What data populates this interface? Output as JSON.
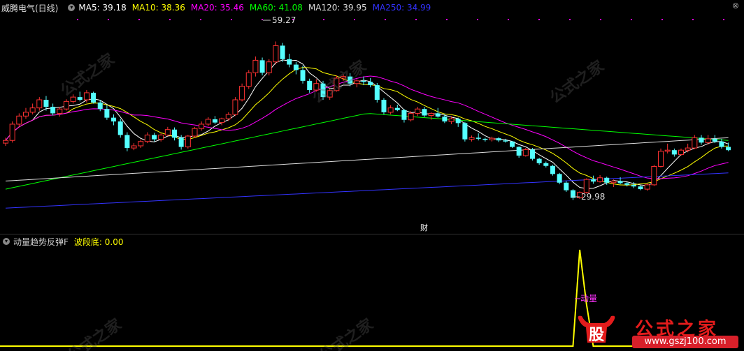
{
  "legend": {
    "stock_name": "威腾电气(日线)",
    "ma": [
      {
        "label": "MA5: 39.18",
        "color": "#ffffff"
      },
      {
        "label": "MA10: 38.36",
        "color": "#ffff00"
      },
      {
        "label": "MA20: 35.46",
        "color": "#ff00ff"
      },
      {
        "label": "MA60: 41.08",
        "color": "#00ff00"
      },
      {
        "label": "MA120: 39.95",
        "color": "#dddddd"
      },
      {
        "label": "MA250: 34.99",
        "color": "#3333ff"
      }
    ]
  },
  "annotations": {
    "high": "59.27",
    "low": "29.98",
    "event_marker": "财"
  },
  "indicator": {
    "name": "动量趋势反弹F",
    "value_label": "波段底: 0.00",
    "tag": "动量"
  },
  "watermark": {
    "text": "公式之家",
    "url": "www.gszj100.com",
    "logo_char": "股"
  },
  "icons": {
    "settings": "circle-down-icon",
    "close": "close-icon"
  },
  "colors": {
    "up": "#ff3232",
    "down": "#54ffff",
    "background": "#000000",
    "indicator": "#ffff00"
  },
  "chart_data": {
    "type": "candlestick",
    "ylim": [
      27.5,
      61
    ],
    "candles": [
      [
        40.5,
        41.5,
        40.0,
        41.0
      ],
      [
        41.0,
        44.5,
        40.6,
        44.0
      ],
      [
        44.0,
        46.0,
        43.5,
        45.5
      ],
      [
        45.5,
        47.0,
        45.0,
        46.2
      ],
      [
        46.2,
        47.8,
        45.8,
        47.0
      ],
      [
        47.0,
        49.0,
        46.5,
        48.5
      ],
      [
        48.5,
        49.2,
        46.5,
        47.2
      ],
      [
        47.2,
        47.8,
        45.6,
        46.0
      ],
      [
        46.0,
        47.2,
        45.4,
        46.8
      ],
      [
        46.8,
        48.6,
        46.5,
        48.2
      ],
      [
        48.2,
        49.5,
        47.8,
        49.0
      ],
      [
        49.0,
        50.0,
        48.2,
        48.5
      ],
      [
        48.5,
        50.3,
        48.0,
        49.8
      ],
      [
        49.8,
        50.0,
        47.8,
        48.0
      ],
      [
        48.0,
        48.5,
        46.4,
        46.8
      ],
      [
        46.8,
        47.5,
        44.8,
        45.2
      ],
      [
        45.2,
        45.8,
        43.8,
        44.5
      ],
      [
        44.5,
        45.0,
        41.5,
        42.0
      ],
      [
        42.0,
        42.5,
        39.0,
        39.6
      ],
      [
        39.6,
        40.5,
        39.2,
        40.0
      ],
      [
        40.0,
        41.2,
        39.6,
        40.8
      ],
      [
        40.8,
        42.5,
        40.5,
        42.0
      ],
      [
        42.0,
        42.4,
        40.8,
        41.2
      ],
      [
        41.2,
        42.3,
        40.8,
        42.0
      ],
      [
        42.0,
        43.5,
        41.8,
        43.0
      ],
      [
        43.0,
        43.4,
        41.0,
        41.5
      ],
      [
        41.5,
        42.0,
        39.3,
        39.8
      ],
      [
        39.8,
        42.0,
        39.5,
        41.8
      ],
      [
        41.8,
        43.5,
        41.5,
        43.2
      ],
      [
        43.2,
        44.5,
        42.8,
        44.0
      ],
      [
        44.0,
        45.3,
        43.6,
        44.9
      ],
      [
        44.9,
        45.5,
        44.0,
        44.3
      ],
      [
        44.3,
        45.2,
        43.8,
        45.0
      ],
      [
        45.0,
        46.2,
        44.6,
        45.8
      ],
      [
        45.8,
        49.0,
        45.5,
        48.5
      ],
      [
        48.5,
        51.5,
        48.2,
        51.0
      ],
      [
        51.0,
        54.0,
        50.5,
        53.5
      ],
      [
        53.5,
        56.5,
        52.8,
        55.8
      ],
      [
        55.8,
        56.3,
        53.0,
        53.5
      ],
      [
        53.5,
        56.0,
        53.0,
        55.5
      ],
      [
        55.5,
        59.27,
        55.0,
        58.5
      ],
      [
        58.5,
        59.0,
        55.5,
        56.0
      ],
      [
        56.0,
        57.0,
        54.5,
        55.0
      ],
      [
        55.0,
        55.5,
        53.2,
        54.0
      ],
      [
        54.0,
        54.8,
        51.5,
        52.0
      ],
      [
        52.0,
        52.4,
        49.8,
        50.3
      ],
      [
        50.3,
        52.3,
        50.0,
        51.5
      ],
      [
        51.5,
        52.0,
        48.5,
        49.0
      ],
      [
        49.0,
        50.5,
        48.5,
        50.2
      ],
      [
        50.2,
        53.0,
        50.0,
        52.5
      ],
      [
        52.5,
        53.2,
        52.0,
        52.8
      ],
      [
        52.8,
        53.4,
        51.0,
        51.5
      ],
      [
        51.5,
        52.3,
        50.8,
        52.0
      ],
      [
        52.0,
        52.8,
        51.2,
        51.8
      ],
      [
        51.8,
        52.5,
        50.8,
        51.2
      ],
      [
        51.2,
        51.6,
        48.0,
        48.5
      ],
      [
        48.5,
        48.8,
        45.8,
        46.2
      ],
      [
        46.2,
        47.5,
        45.8,
        47.0
      ],
      [
        47.0,
        47.6,
        46.4,
        46.6
      ],
      [
        46.6,
        46.8,
        44.3,
        44.8
      ],
      [
        44.8,
        46.4,
        44.5,
        46.0
      ],
      [
        46.0,
        47.2,
        45.5,
        46.8
      ],
      [
        46.8,
        47.2,
        45.3,
        45.6
      ],
      [
        45.6,
        46.2,
        44.8,
        46.0
      ],
      [
        46.0,
        47.0,
        45.2,
        45.4
      ],
      [
        45.4,
        45.8,
        44.2,
        44.5
      ],
      [
        44.5,
        45.5,
        44.0,
        45.0
      ],
      [
        45.0,
        45.2,
        43.5,
        44.2
      ],
      [
        44.2,
        44.4,
        40.8,
        41.2
      ],
      [
        41.2,
        41.9,
        40.8,
        41.5
      ],
      [
        41.5,
        42.3,
        41.0,
        41.3
      ],
      [
        41.3,
        41.5,
        40.8,
        41.1
      ],
      [
        41.1,
        41.7,
        40.8,
        41.4
      ],
      [
        41.4,
        41.6,
        40.7,
        41.0
      ],
      [
        41.0,
        41.3,
        40.6,
        40.8
      ],
      [
        40.8,
        40.9,
        39.6,
        39.8
      ],
      [
        39.8,
        39.9,
        37.8,
        38.2
      ],
      [
        38.2,
        39.6,
        38.0,
        39.3
      ],
      [
        39.3,
        39.6,
        37.3,
        37.6
      ],
      [
        37.6,
        37.8,
        36.5,
        36.8
      ],
      [
        36.8,
        37.1,
        36.0,
        36.3
      ],
      [
        36.3,
        36.5,
        34.5,
        34.8
      ],
      [
        34.8,
        35.0,
        32.9,
        33.2
      ],
      [
        33.2,
        33.5,
        31.5,
        31.8
      ],
      [
        31.8,
        32.0,
        29.98,
        30.4
      ],
      [
        30.4,
        31.6,
        30.2,
        31.4
      ],
      [
        31.4,
        34.0,
        31.2,
        33.8
      ],
      [
        33.8,
        34.5,
        33.0,
        33.4
      ],
      [
        33.4,
        34.6,
        33.2,
        34.1
      ],
      [
        34.1,
        34.3,
        32.8,
        33.2
      ],
      [
        33.2,
        33.8,
        32.4,
        33.5
      ],
      [
        33.5,
        34.2,
        32.9,
        33.1
      ],
      [
        33.1,
        33.3,
        32.5,
        32.8
      ],
      [
        32.8,
        33.3,
        32.2,
        32.5
      ],
      [
        32.5,
        32.7,
        31.8,
        32.0
      ],
      [
        32.0,
        33.0,
        31.7,
        32.8
      ],
      [
        32.8,
        36.5,
        32.6,
        36.2
      ],
      [
        36.2,
        39.5,
        36.0,
        39.0
      ],
      [
        39.0,
        40.4,
        38.6,
        39.2
      ],
      [
        39.2,
        39.5,
        38.0,
        38.4
      ],
      [
        38.4,
        39.5,
        38.2,
        39.2
      ],
      [
        39.2,
        40.4,
        38.8,
        39.6
      ],
      [
        39.6,
        42.0,
        39.4,
        41.5
      ],
      [
        41.5,
        42.0,
        40.2,
        40.6
      ],
      [
        40.6,
        42.0,
        40.2,
        41.3
      ],
      [
        41.3,
        42.0,
        40.5,
        40.8
      ],
      [
        40.8,
        41.3,
        39.5,
        39.8
      ],
      [
        39.8,
        40.6,
        39.0,
        39.2
      ]
    ],
    "indicator_series": [
      0,
      0,
      0,
      0,
      0,
      0,
      0,
      0,
      0,
      0,
      0,
      0,
      0,
      0,
      0,
      0,
      0,
      0,
      0,
      0,
      0,
      0,
      0,
      0,
      0,
      0,
      0,
      0,
      0,
      0,
      0,
      0,
      0,
      0,
      0,
      0,
      0,
      0,
      0,
      0,
      0,
      0,
      0,
      0,
      0,
      0,
      0,
      0,
      0,
      0,
      0,
      0,
      0,
      0,
      0,
      0,
      0,
      0,
      0,
      0,
      0,
      0,
      0,
      0,
      0,
      0,
      0,
      0,
      0,
      0,
      0,
      0,
      0,
      0,
      0,
      0,
      0,
      0,
      0,
      0,
      0,
      0,
      0,
      0,
      0,
      0,
      0,
      0,
      0,
      0,
      0,
      0,
      0,
      0,
      0,
      0,
      0,
      0,
      0,
      0,
      0,
      0,
      0,
      0,
      0,
      0,
      0,
      0,
      0
    ],
    "indicator_spike": {
      "index": 85,
      "value": 1
    }
  }
}
